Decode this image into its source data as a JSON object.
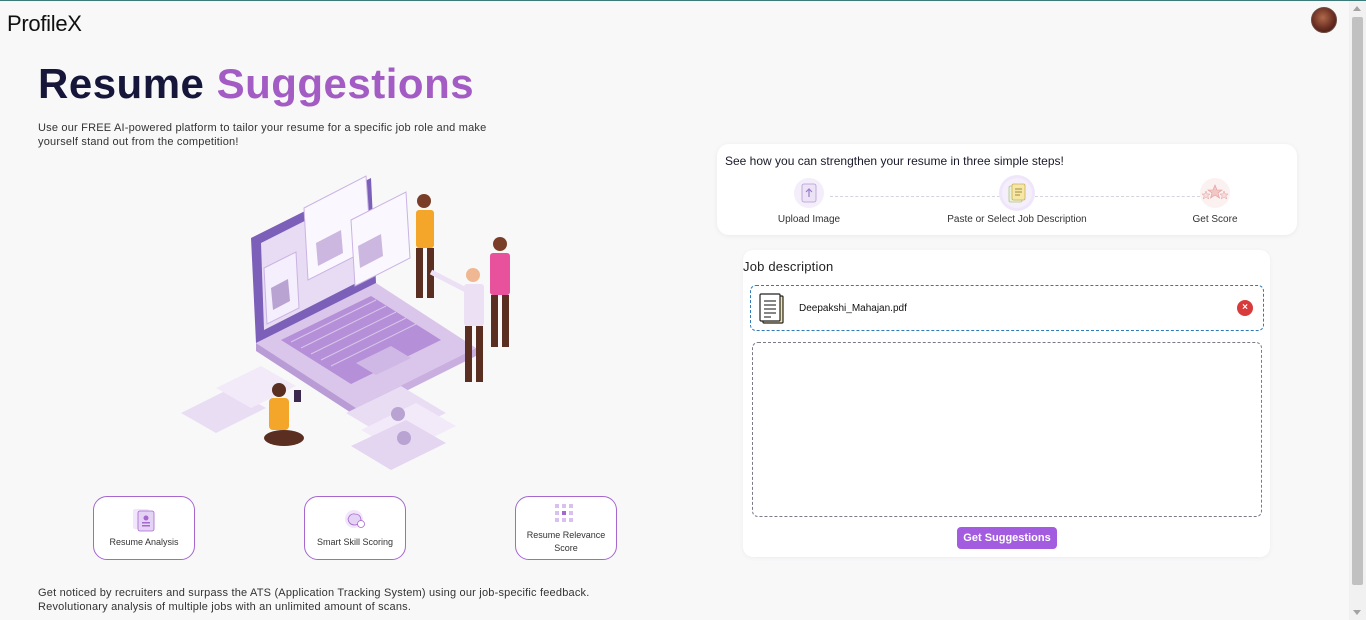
{
  "app": {
    "logo": "ProfileX"
  },
  "hero": {
    "title_part1": "Resume",
    "title_part2": "Suggestions",
    "subtitle": "Use our FREE AI-powered platform to tailor your resume for a specific job role and make yourself stand out from the competition!"
  },
  "features": [
    {
      "label": "Resume Analysis",
      "icon": "resume-analysis-icon"
    },
    {
      "label": "Smart Skill Scoring",
      "icon": "brain-icon"
    },
    {
      "label": "Resume Relevance Score",
      "icon": "relevance-grid-icon"
    }
  ],
  "bottom_text": {
    "line1": "Get noticed by recruiters and surpass the ATS (Application Tracking System) using our job-specific feedback.",
    "line2": "Revolutionary analysis of multiple jobs with an unlimited amount of scans."
  },
  "steps": {
    "title": "See how you can strengthen your resume in three simple steps!",
    "items": [
      {
        "label": "Upload Image",
        "icon": "upload-doc-icon"
      },
      {
        "label": "Paste or Select Job Description",
        "icon": "job-description-icon"
      },
      {
        "label": "Get Score",
        "icon": "stars-icon"
      }
    ]
  },
  "job_description": {
    "label": "Job description",
    "file_name": "Deepakshi_Mahajan.pdf",
    "remove_label": "×",
    "textarea_value": "",
    "button_label": "Get Suggestions"
  },
  "colors": {
    "accent": "#a35cc4",
    "button": "#a35ce0",
    "title_dark": "#16163a",
    "remove": "#d93a3a"
  }
}
